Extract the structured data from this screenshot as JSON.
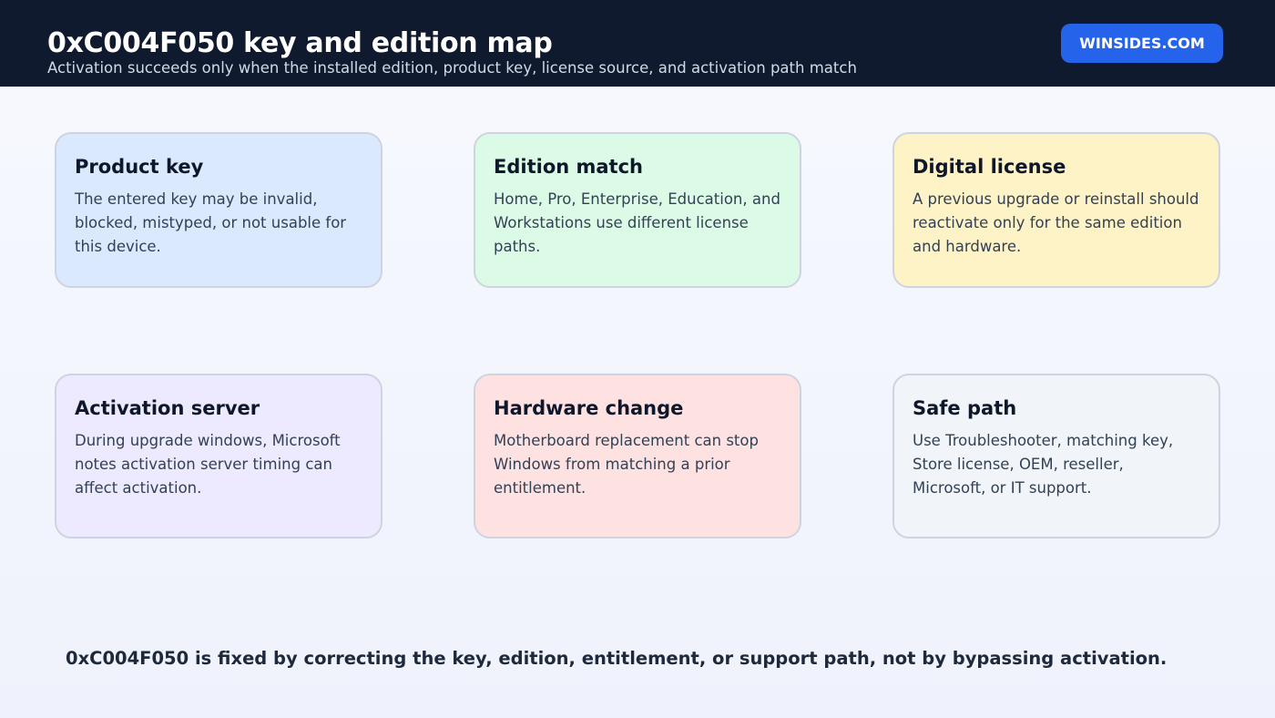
{
  "header": {
    "title": "0xC004F050 key and edition map",
    "subtitle": "Activation succeeds only when the installed edition, product key, license source, and activation path match",
    "brand": "WINSIDES.COM"
  },
  "cards": [
    {
      "title": "Product key",
      "body": "The entered key may be invalid, blocked, mistyped, or not usable for this device.",
      "color": "#dbe9fe"
    },
    {
      "title": "Edition match",
      "body": "Home, Pro, Enterprise, Education, and Workstations use different license paths.",
      "color": "#dcfbe7"
    },
    {
      "title": "Digital license",
      "body": "A previous upgrade or reinstall should reactivate only for the same edition and hardware.",
      "color": "#fef3c7"
    },
    {
      "title": "Activation server",
      "body": "During upgrade windows, Microsoft notes activation server timing can affect activation.",
      "color": "#ede9fe"
    },
    {
      "title": "Hardware change",
      "body": "Motherboard replacement can stop Windows from matching a prior entitlement.",
      "color": "#fee2e2"
    },
    {
      "title": "Safe path",
      "body": "Use Troubleshooter, matching key, Store license, OEM, reseller, Microsoft, or IT support.",
      "color": "#f1f4f8"
    }
  ],
  "footer": "0xC004F050 is fixed by correcting the key, edition, entitlement, or support path, not by bypassing activation."
}
